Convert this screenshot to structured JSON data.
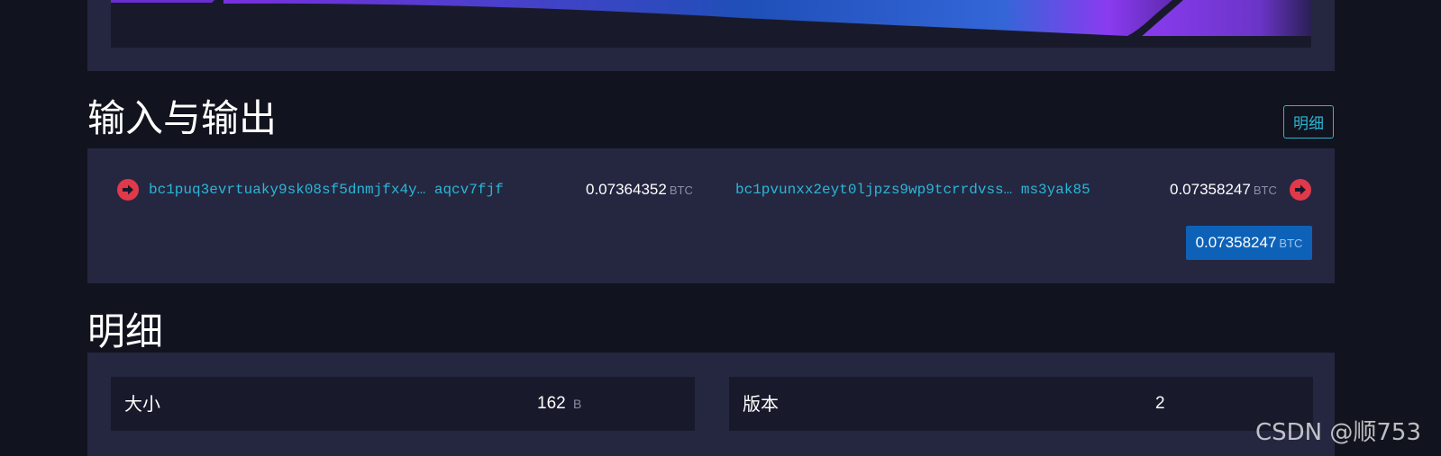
{
  "io_section": {
    "title": "输入与输出",
    "detail_button": "明细",
    "inputs": [
      {
        "address": "bc1puq3evrtuaky9sk08sf5dnmjfx4y… aqcv7fjf",
        "amount": "0.07364352",
        "unit": "BTC",
        "icon": "arrow-right-circle-icon"
      }
    ],
    "outputs": [
      {
        "address": "bc1pvunxx2eyt0ljpzs9wp9tcrrdvss… ms3yak85",
        "amount": "0.07358247",
        "unit": "BTC",
        "icon": "arrow-right-circle-icon"
      }
    ],
    "total": {
      "amount": "0.07358247",
      "unit": "BTC"
    }
  },
  "details_section": {
    "title": "明细",
    "rows": [
      [
        {
          "label": "大小",
          "value": "162",
          "unit": "B"
        },
        {
          "label": "版本",
          "value": "2",
          "unit": ""
        }
      ]
    ]
  },
  "colors": {
    "background": "#11131e",
    "card": "#252741",
    "cell": "#181a2c",
    "link": "#2bb6d6",
    "arrow": "#e0394a",
    "total_box": "#0d62b8"
  },
  "watermark": "CSDN @顺753"
}
